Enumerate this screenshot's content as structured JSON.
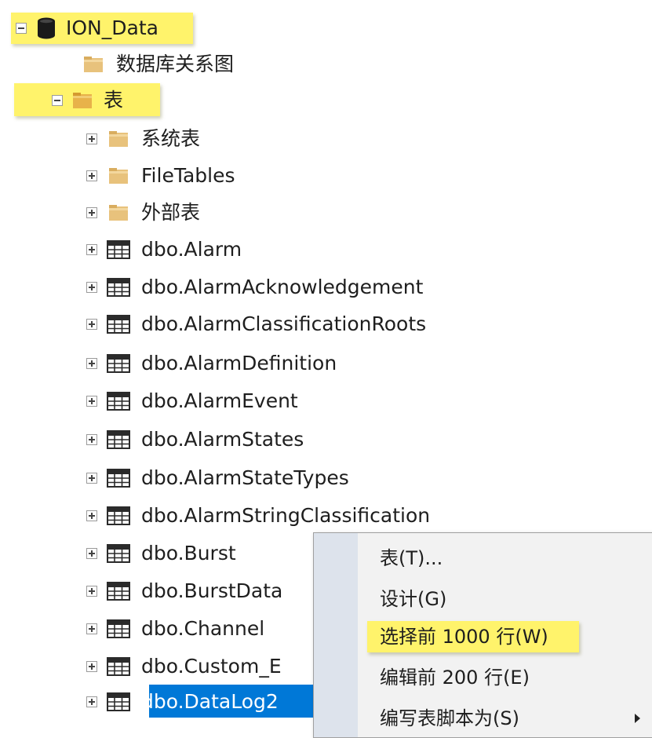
{
  "tree": {
    "database": {
      "label": "ION_Data",
      "icon": "database-icon"
    },
    "db_diagrams": {
      "label": "数据库关系图",
      "icon": "folder-icon"
    },
    "tables_folder": {
      "label": "表",
      "icon": "folder-icon"
    },
    "tables": [
      {
        "label": "系统表",
        "icon": "folder-icon"
      },
      {
        "label": "FileTables",
        "icon": "folder-icon"
      },
      {
        "label": "外部表",
        "icon": "folder-icon"
      },
      {
        "label": "dbo.Alarm",
        "icon": "table-icon"
      },
      {
        "label": "dbo.AlarmAcknowledgement",
        "icon": "table-icon"
      },
      {
        "label": "dbo.AlarmClassificationRoots",
        "icon": "table-icon"
      },
      {
        "label": "dbo.AlarmDefinition",
        "icon": "table-icon"
      },
      {
        "label": "dbo.AlarmEvent",
        "icon": "table-icon"
      },
      {
        "label": "dbo.AlarmStates",
        "icon": "table-icon"
      },
      {
        "label": "dbo.AlarmStateTypes",
        "icon": "table-icon"
      },
      {
        "label": "dbo.AlarmStringClassification",
        "icon": "table-icon"
      },
      {
        "label": "dbo.Burst",
        "icon": "table-icon"
      },
      {
        "label": "dbo.BurstData",
        "icon": "table-icon"
      },
      {
        "label": "dbo.Channel",
        "icon": "table-icon"
      },
      {
        "label": "dbo.Custom_E",
        "icon": "table-icon"
      },
      {
        "label": "dbo.DataLog2",
        "icon": "table-icon",
        "selected": true
      }
    ]
  },
  "context_menu": {
    "items": [
      {
        "label": "表(T)..."
      },
      {
        "label": "设计(G)"
      },
      {
        "label": "选择前 1000 行(W)",
        "highlighted": true
      },
      {
        "label": "编辑前 200 行(E)"
      },
      {
        "label": "编写表脚本为(S)",
        "has_submenu": true
      }
    ]
  },
  "colors": {
    "highlight": "#fff36b",
    "selection": "#0078d7",
    "menu_background": "#f2f2f2",
    "menu_gutter": "#dde3ec",
    "folder": "#e8c27c",
    "database": "#1a1a1a"
  }
}
